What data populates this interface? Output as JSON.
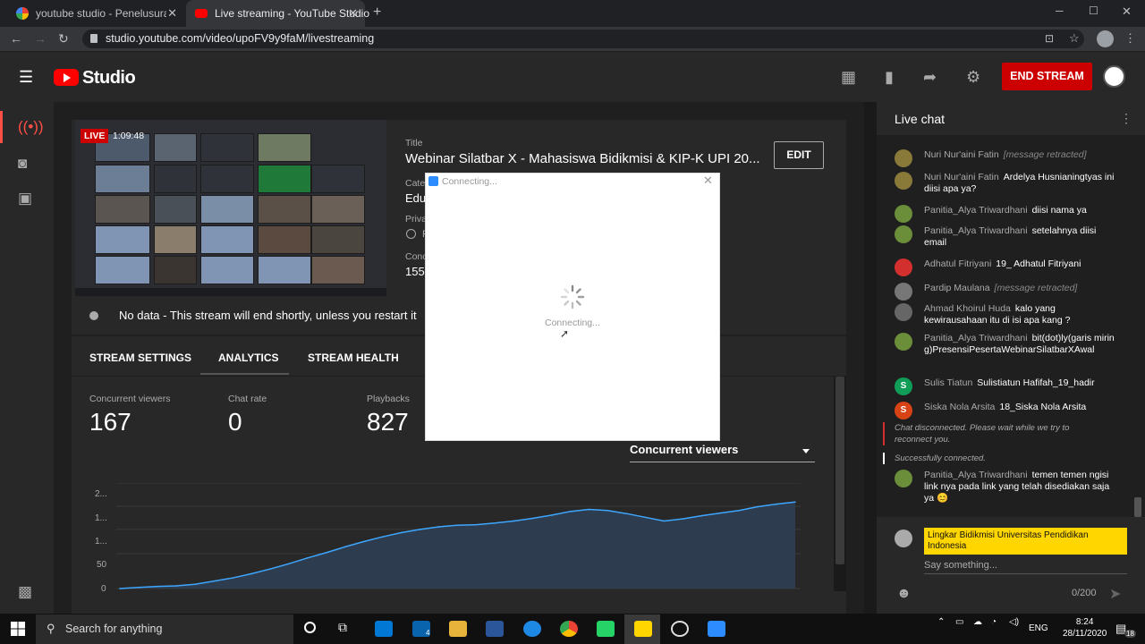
{
  "browser": {
    "tabs": [
      {
        "title": "youtube studio - Penelusuran Go",
        "favicon": "google-icon",
        "active": false
      },
      {
        "title": "Live streaming - YouTube Studio",
        "favicon": "youtube-icon",
        "active": true
      }
    ],
    "url": "studio.youtube.com/video/upoFV9y9faM/livestreaming"
  },
  "header": {
    "brand": "Studio",
    "end_stream": "END STREAM"
  },
  "stream": {
    "live_badge": "LIVE",
    "duration": "1:09:48",
    "title_label": "Title",
    "title": "Webinar Silatbar X - Mahasiswa Bidikmisi & KIP-K UPI 20...",
    "category_label": "Cate",
    "category_partial": "Edu",
    "privacy_label": "Priva",
    "privacy_partial": "F",
    "concurrent_label": "Conc",
    "concurrent_partial": "155",
    "edit": "EDIT",
    "no_data": "No data - This stream will end shortly, unless you restart it"
  },
  "tabs": [
    "STREAM SETTINGS",
    "ANALYTICS",
    "STREAM HEALTH"
  ],
  "stats": [
    {
      "label": "Concurrent viewers",
      "value": "167"
    },
    {
      "label": "Chat rate",
      "value": "0"
    },
    {
      "label": "Playbacks",
      "value": "827"
    }
  ],
  "metric_select": "Concurrent viewers",
  "chart_data": {
    "type": "area",
    "y_tick_labels": [
      "2...",
      "1...",
      "1...",
      "50",
      "0"
    ],
    "ylim": [
      0,
      200
    ],
    "values": [
      0,
      2,
      4,
      5,
      8,
      14,
      20,
      28,
      37,
      47,
      58,
      68,
      79,
      89,
      98,
      106,
      112,
      117,
      120,
      121,
      124,
      128,
      133,
      139,
      146,
      150,
      148,
      142,
      135,
      128,
      132,
      138,
      143,
      148,
      155,
      160,
      164
    ],
    "color": "#3ea6ff"
  },
  "dialog": {
    "title": "Connecting...",
    "status": "Connecting..."
  },
  "chat": {
    "title": "Live chat",
    "messages": [
      {
        "author": "Nuri Nur'aini Fatin",
        "text": "[message retracted]",
        "retracted": true,
        "avatar": "#8a7a3a",
        "initial": "▲"
      },
      {
        "author": "Nuri Nur'aini Fatin",
        "text": "Ardelya Husnianingtyas ini diisi apa ya?",
        "retracted": false,
        "avatar": "#8a7a3a",
        "initial": "▲"
      },
      {
        "author": "Panitia_Alya Triwardhani",
        "text": "diisi nama ya",
        "retracted": false,
        "avatar": "#6b8e3a",
        "initial": ""
      },
      {
        "author": "Panitia_Alya Triwardhani",
        "text": "setelahnya diisi email",
        "retracted": false,
        "avatar": "#6b8e3a",
        "initial": ""
      },
      {
        "author": "Adhatul Fitriyani",
        "text": "19_ Adhatul Fitriyani",
        "retracted": false,
        "avatar": "#d32f2f",
        "initial": ""
      },
      {
        "author": "Pardip Maulana",
        "text": "[message retracted]",
        "retracted": true,
        "avatar": "#777",
        "initial": ""
      },
      {
        "author": "Ahmad Khoirul Huda",
        "text": "kalo yang kewirausahaan itu di isi apa kang ?",
        "retracted": false,
        "avatar": "#666",
        "initial": ""
      },
      {
        "author": "Panitia_Alya Triwardhani",
        "text": "bit(dot)ly(garis miring)PresensiPesertaWebinarSilatbarXAwal",
        "retracted": false,
        "avatar": "#6b8e3a",
        "initial": ""
      },
      {
        "author": "Sulis Tiatun",
        "text": "Sulistiatun Hafifah_19_hadir",
        "retracted": false,
        "avatar": "#0f9d58",
        "initial": "S"
      },
      {
        "author": "Siska Nola Arsita",
        "text": "18_Siska Nola Arsita",
        "retracted": false,
        "avatar": "#d84315",
        "initial": "S"
      }
    ],
    "system1": "Chat disconnected. Please wait while we try to reconnect you.",
    "system2": "Successfully connected.",
    "last_message": {
      "author": "Panitia_Alya Triwardhani",
      "text": "temen temen ngisi link nya pada link yang telah disediakan saja ya 😊",
      "avatar": "#6b8e3a"
    },
    "input_author": "Lingkar Bidikmisi Universitas Pendidikan Indonesia",
    "input_placeholder": "Say something...",
    "char_count": "0/200"
  },
  "taskbar": {
    "search": "Search for anything",
    "lang": "ENG",
    "time": "8:24",
    "date": "28/11/2020",
    "notif": "18",
    "mail_badge": "4"
  }
}
